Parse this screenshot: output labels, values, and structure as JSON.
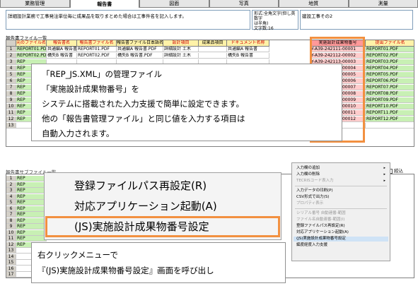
{
  "tabs": [
    {
      "label": "業務管理",
      "active": false
    },
    {
      "label": "報告書",
      "active": true
    },
    {
      "label": "図面",
      "active": false
    },
    {
      "label": "写真",
      "active": false
    },
    {
      "label": "地質",
      "active": false
    },
    {
      "label": "測量",
      "active": false
    }
  ],
  "top": {
    "note": "詳細設計業務で工事発注単位毎に成果品を取りまとめた場合は工事件名を記入します。",
    "format_lines": [
      "形式:全角文字(但し英数字",
      "は半角)",
      "文字数:16"
    ],
    "construction_type": "建設工事その2"
  },
  "group1": {
    "title": "報告書ファイル一覧",
    "headers": [
      "",
      "元のファイル名",
      "報告書名",
      "報告書ファイル名",
      "報告書ファイル日本語名",
      "設計項目",
      "成果品項目",
      "ドキュメント名称",
      "実施設計成果物番号",
      "提出ファイル名"
    ],
    "rows": [
      [
        "1",
        "REPORT01.PDF",
        "共通編A 報告書",
        "REPORT01.PDF",
        "共通編A 報告書.PDF",
        "詳細設計 土木",
        "",
        "共通編A 報告書",
        "Y-A39-242111-00001",
        "REPORT01.PDF"
      ],
      [
        "2",
        "REPORT02.PDF",
        "構失B 報告書",
        "REPORT02.PDF",
        "構失B 報告書.PDF",
        "詳細設計 土木",
        "",
        "構失B 報告書",
        "Y-A39-242112-00002",
        "REPORT02.PDF"
      ],
      [
        "3",
        "REP",
        "",
        "",
        "",
        "",
        "",
        "",
        "Y-A39-242113-00003",
        "REPORT03.PDF"
      ],
      [
        "4",
        "REP",
        "",
        "",
        "",
        "",
        "",
        "",
        "Y-A39-242114-00004",
        "REPORT04.PDF"
      ],
      [
        "5",
        "REP",
        "",
        "",
        "",
        "",
        "",
        "",
        "Y-A39-242124-00005",
        "REPORT05.PDF"
      ],
      [
        "6",
        "REP",
        "",
        "",
        "",
        "",
        "",
        "",
        "Y-A39-242511-00006",
        "REPORT06.PDF"
      ],
      [
        "7",
        "REP",
        "",
        "",
        "",
        "",
        "",
        "",
        "Y-A39-242513-00007",
        "REPORT07.PDF"
      ],
      [
        "8",
        "REP",
        "",
        "",
        "",
        "",
        "",
        "",
        "Y-A39-242514-00008",
        "REPORT08.PDF"
      ],
      [
        "9",
        "REP",
        "",
        "",
        "",
        "",
        "",
        "",
        "Y-A39-242515-00009",
        "REPORT09.PDF"
      ],
      [
        "10",
        "REP",
        "",
        "",
        "",
        "",
        "",
        "",
        "Y-A39-242515-00010",
        "REPORT10.PDF"
      ],
      [
        "11",
        "REP",
        "",
        "",
        "",
        "",
        "",
        "",
        "Y-A39-242515-00011",
        "REPORT11.PDF"
      ],
      [
        "12",
        "REP",
        "",
        "",
        "",
        "",
        "",
        "",
        "Y-A20-242523-00012",
        "REPORT12.PDF"
      ],
      [
        "13",
        "",
        "",
        "",
        "",
        "",
        "",
        "",
        "",
        ""
      ]
    ]
  },
  "callout1": [
    "「REP_JS.XML」の管理ファイル",
    "「実施設計成果物番号」を",
    "システムに搭載された入力支援で簡単に設定できます。",
    "他の「報告書管理ファイル」と同じ値を入力する項目は",
    "自動入力されます。"
  ],
  "group2": {
    "title": "報告書サブファイル一覧",
    "checkbox_label": "絞込",
    "row_prefix": "REP",
    "rows": [
      "1",
      "2",
      "3",
      "4",
      "5",
      "6",
      "7",
      "8",
      "9",
      "10",
      "11",
      "12",
      "13",
      "14",
      "15",
      "16",
      "17"
    ]
  },
  "big_menu": [
    "登録ファイルパス再設定(R)",
    "対応アプリケーション起動(A)",
    "(JS)実施設計成果物番号設定"
  ],
  "callout2": [
    "右クリックメニューで",
    "『(JS)実施設計成果物番号設定』画面を呼び出し"
  ],
  "small_menu": [
    {
      "label": "入力欄の追加",
      "disabled": false,
      "submenu": true
    },
    {
      "label": "入力欄の削除",
      "disabled": false,
      "submenu": true
    },
    {
      "label": "TECRISコード表入力",
      "disabled": true,
      "submenu": true
    },
    {
      "label": "入力データの印刷(P)",
      "disabled": false,
      "submenu": false
    },
    {
      "label": "CSV形式で出力(S)",
      "disabled": false,
      "submenu": false
    },
    {
      "label": "プロパティ表示",
      "disabled": true,
      "submenu": false
    },
    {
      "label": "シリアル番号 自動連番-範囲",
      "disabled": true,
      "submenu": false
    },
    {
      "label": "ファイル名自動連番-範囲(I)",
      "disabled": true,
      "submenu": false
    },
    {
      "label": "登録ファイルパス再設定(R)",
      "disabled": false,
      "submenu": false
    },
    {
      "label": "対応アプリケーション起動(A)",
      "disabled": false,
      "submenu": false
    },
    {
      "label": "(JS)実施設計成果物番号設定",
      "disabled": false,
      "submenu": false,
      "selected": true
    },
    {
      "label": "編度経度入力支援",
      "disabled": false,
      "submenu": false
    }
  ],
  "colors": {
    "highlight": "#f29040",
    "header_yellow": "#fff2a8",
    "header_pink": "#ff9999",
    "cell_green": "#c8f0b4",
    "cell_salmon": "#ffcccc"
  }
}
